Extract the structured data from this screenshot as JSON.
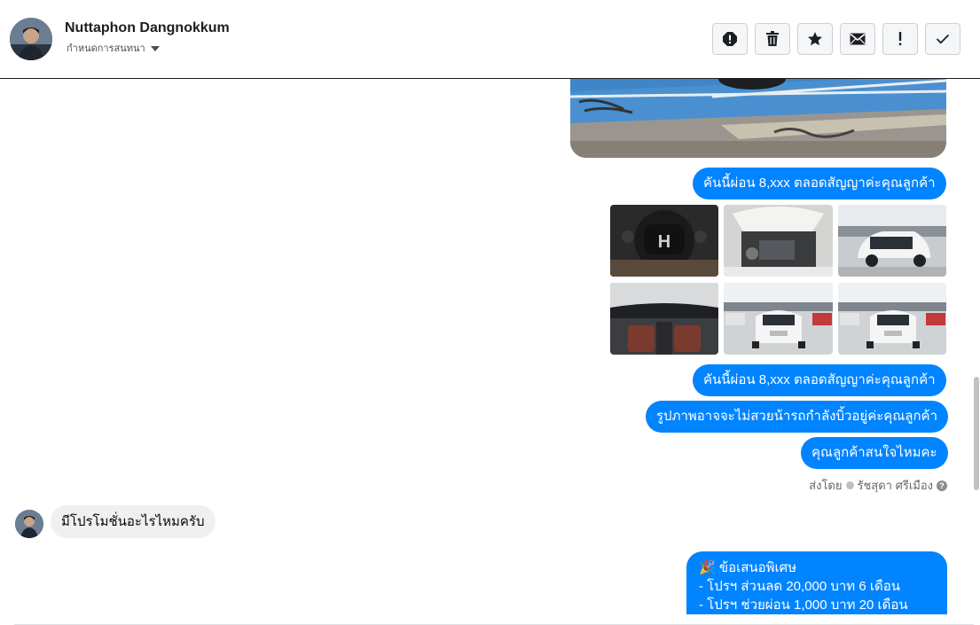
{
  "header": {
    "contact_name": "Nuttaphon Dangnokkum",
    "subtitle": "กำหนดการสนทนา",
    "actions": [
      {
        "name": "report-icon",
        "label": "report"
      },
      {
        "name": "trash-icon",
        "label": "delete"
      },
      {
        "name": "star-icon",
        "label": "star"
      },
      {
        "name": "envelope-icon",
        "label": "mark unread"
      },
      {
        "name": "exclamation-icon",
        "label": "important"
      },
      {
        "name": "check-icon",
        "label": "done"
      }
    ]
  },
  "messages": {
    "m1": "คันนี้ผ่อน 8,xxx ตลอดสัญญาค่ะคุณลูกค้า",
    "m2": "คันนี้ผ่อน 8,xxx ตลอดสัญญาค่ะคุณลูกค้า",
    "m3": "รูปภาพอาจจะไม่สวยน้ารถกำลังบิ้วอยู่ค่ะคุณลูกค้า",
    "m4": "คุณลูกค้าสนใจไหมคะ",
    "sent_by_prefix": "ส่งโดย",
    "sent_by_name": "รัชสุดา ศรีเมือง",
    "incoming": "มีโปรโมชั่นอะไรไหมครับ",
    "offer_title": "🎉 ข้อเสนอพิเศษ",
    "offer_line1": "- โปรฯ ส่วนลด 20,000 บาท 6 เดือน",
    "offer_line2": "- โปรฯ ช่วยผ่อน 1,000 บาท 20 เดือน"
  },
  "colors": {
    "sent_bubble": "#0084ff",
    "received_bubble": "#f0f0f0"
  }
}
